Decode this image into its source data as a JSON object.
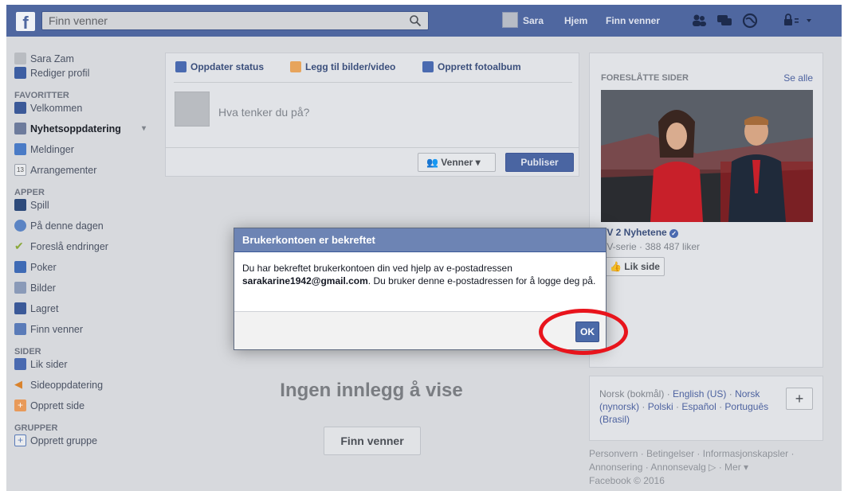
{
  "topbar": {
    "logo": "f",
    "search_placeholder": "Finn venner",
    "user_name": "Sara",
    "home": "Hjem",
    "find_friends": "Finn venner"
  },
  "sidebar": {
    "profile_name": "Sara Zam",
    "edit_profile": "Rediger profil",
    "sections": [
      {
        "heading": "FAVORITTER",
        "items": [
          "Velkommen",
          "Nyhetsoppdatering",
          "Meldinger",
          "Arrangementer"
        ]
      },
      {
        "heading": "APPER",
        "items": [
          "Spill",
          "På denne dagen",
          "Foreslå endringer",
          "Poker",
          "Bilder",
          "Lagret",
          "Finn venner"
        ]
      },
      {
        "heading": "SIDER",
        "items": [
          "Lik sider",
          "Sideoppdatering",
          "Opprett side"
        ]
      },
      {
        "heading": "GRUPPER",
        "items": [
          "Opprett gruppe"
        ]
      }
    ]
  },
  "composer": {
    "tabs": [
      "Oppdater status",
      "Legg til bilder/video",
      "Opprett fotoalbum"
    ],
    "placeholder": "Hva tenker du på?",
    "audience": "Venner",
    "publish": "Publiser"
  },
  "feed": {
    "empty_text": "Ingen innlegg å vise",
    "find_friends_button": "Finn venner"
  },
  "suggested": {
    "title": "FORESLÅTTE SIDER",
    "see_all": "Se alle",
    "page_name": "TV 2 Nyhetene",
    "page_meta": "TV-serie · 388 487 liker",
    "like_button": "Lik side"
  },
  "languages": {
    "current": "Norsk (bokmål)",
    "options": [
      "English (US)",
      "Norsk (nynorsk)",
      "Polski",
      "Español",
      "Português (Brasil)"
    ],
    "plus": "+"
  },
  "footer": {
    "line1": "Personvern · Betingelser · Informasjonskapsler ·",
    "line2": "Annonsering · Annonsevalg",
    "line2_tail": "· Mer ▾",
    "copyright": "Facebook © 2016"
  },
  "modal": {
    "title": "Brukerkontoen er bekreftet",
    "body_before": "Du har bekreftet brukerkontoen din ved hjelp av e-postadressen ",
    "email": "sarakarine1942@gmail.com",
    "body_after": ". Du bruker denne e-postadressen for å logge deg på.",
    "ok": "OK"
  },
  "colors": {
    "brand": "#4f67a0",
    "modal_header": "#6d84b4",
    "highlight_ring": "#e8141c"
  }
}
